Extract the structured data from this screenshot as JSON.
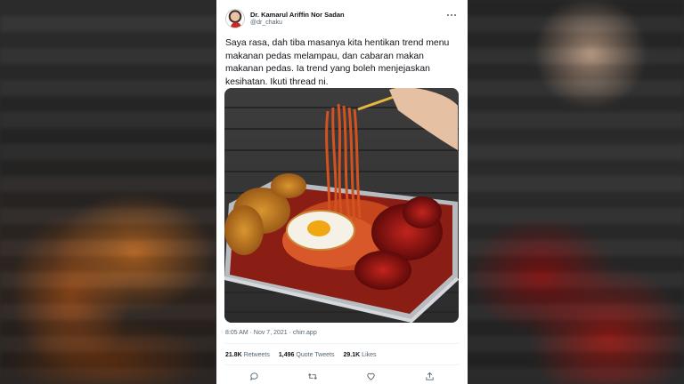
{
  "tweet": {
    "author_name": "Dr. Kamarul Ariffin Nor Sadan",
    "author_handle": "@dr_chaku",
    "text": "Saya rasa, dah tiba masanya kita hentikan trend menu makanan pedas melampau, dan cabaran makan makanan pedas. Ia trend yang boleh menjejaskan kesihatan. Ikuti thread ni.",
    "timestamp": "8:05 AM · Nov 7, 2021 · chirr.app",
    "stats": [
      {
        "count": "21.8K",
        "label": "Retweets"
      },
      {
        "count": "1,496",
        "label": "Quote Tweets"
      },
      {
        "count": "29.1K",
        "label": "Likes"
      }
    ],
    "actions": [
      {
        "icon": "reply-icon"
      },
      {
        "icon": "retweet-icon"
      },
      {
        "icon": "like-icon"
      },
      {
        "icon": "share-icon"
      }
    ],
    "photo_icon": "food-photo",
    "more_icon": "more-options-icon"
  },
  "colors": {
    "text_primary": "#0f1419",
    "text_secondary": "#536471",
    "divider": "#eff3f4"
  }
}
